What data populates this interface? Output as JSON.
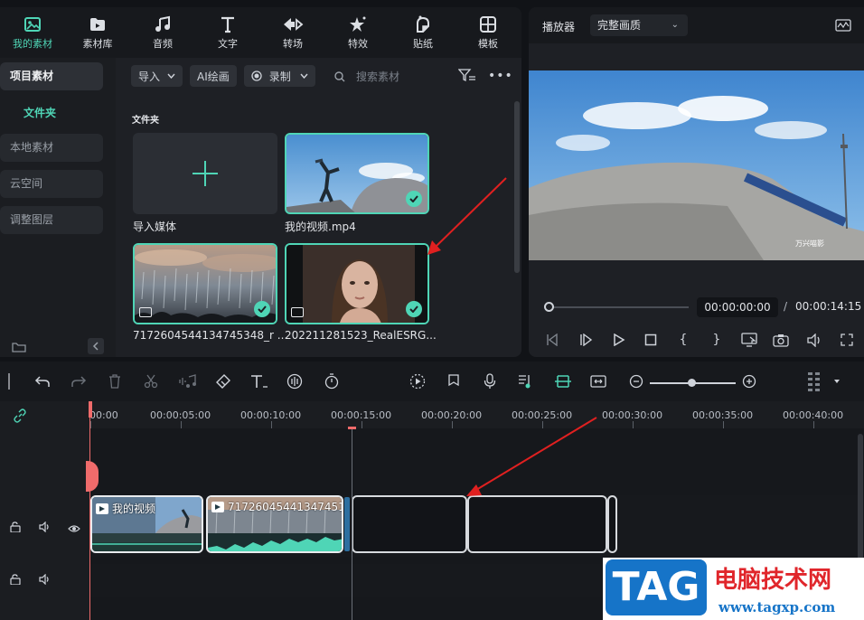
{
  "top_tabs": [
    {
      "label": "我的素材",
      "icon": "my-media-icon",
      "active": true
    },
    {
      "label": "素材库",
      "icon": "stock-library-icon"
    },
    {
      "label": "音频",
      "icon": "music-note-icon"
    },
    {
      "label": "文字",
      "icon": "text-t-icon"
    },
    {
      "label": "转场",
      "icon": "transition-icon"
    },
    {
      "label": "特效",
      "icon": "effects-star-icon"
    },
    {
      "label": "贴纸",
      "icon": "sticker-icon"
    },
    {
      "label": "模板",
      "icon": "template-grid-icon"
    }
  ],
  "sidebar": {
    "project_media": "项目素材",
    "folder": "文件夹",
    "items": [
      "本地素材",
      "云空间",
      "调整图层"
    ]
  },
  "media_toolbar": {
    "import_label": "导入",
    "ai_paint_label": "AI绘画",
    "record_label": "录制",
    "search_placeholder": "搜索素材"
  },
  "media_grid": {
    "section_label": "文件夹",
    "items": [
      {
        "name": "导入媒体",
        "type": "import"
      },
      {
        "name": "我的视频.mp4",
        "selected": true
      },
      {
        "name": "7172604544134745348_r ...",
        "selected": true
      },
      {
        "name": "202211281523_RealESRG...",
        "selected": true
      }
    ]
  },
  "player": {
    "title": "播放器",
    "quality": "完整画质",
    "current_time": "00:00:00:00",
    "separator": "/",
    "total_time": "00:00:14:15",
    "video_watermark": "万兴喵影"
  },
  "timeline": {
    "ruler_labels": [
      "00:00",
      "00:00:05:00",
      "00:00:10:00",
      "00:00:15:00",
      "00:00:20:00",
      "00:00:25:00",
      "00:00:30:00",
      "00:00:35:00",
      "00:00:40:00"
    ],
    "clips": [
      {
        "title": "我的视频"
      },
      {
        "title": "71726045441347451..."
      }
    ]
  },
  "watermark": {
    "tag": "TAG",
    "site_name": "电脑技术网",
    "url": "www.tagxp.com"
  },
  "colors": {
    "accent": "#4fd5b6",
    "playhead": "#ef6b6b",
    "annotation_arrow": "#e02020"
  }
}
